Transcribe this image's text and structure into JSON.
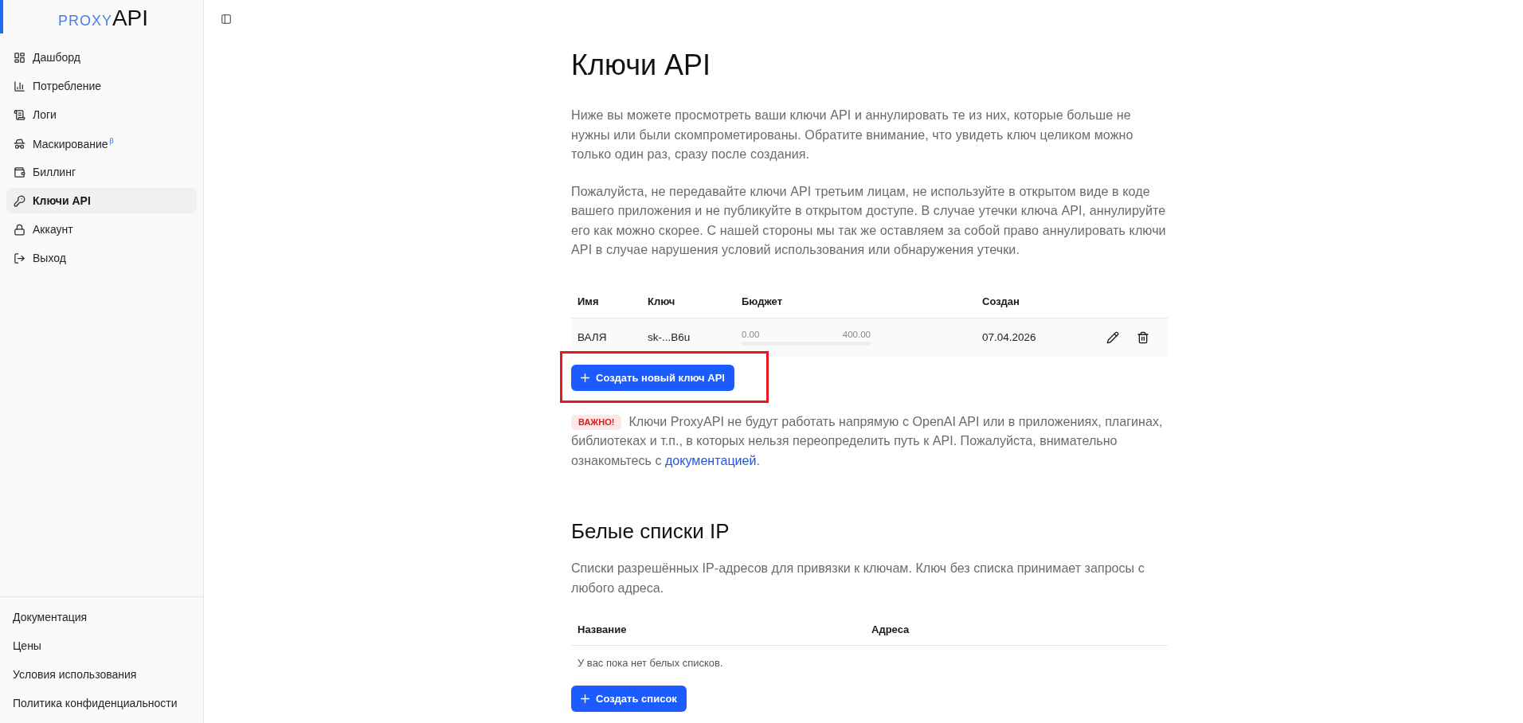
{
  "sidebar": {
    "logo": {
      "part_1": "PROXY",
      "part_2": "API"
    },
    "nav_items": [
      {
        "label": "Дашборд",
        "selected": false
      },
      {
        "label": "Потребление",
        "selected": false
      },
      {
        "label": "Логи",
        "selected": false
      },
      {
        "label": "Маскирование$^{β}$",
        "selected": false
      },
      {
        "label": "Биллинг",
        "selected": false
      },
      {
        "label": "Ключи API",
        "selected": true
      },
      {
        "label": "Аккаунт",
        "selected": false
      },
      {
        "label": "Выход",
        "selected": false
      }
    ],
    "footer_links": [
      "Документация",
      "Цены",
      "Условия использования",
      "Политика конфиденциальности"
    ]
  },
  "page": {
    "title": "Ключи API",
    "paragraphs": [
      "Ниже вы можете просмотреть ваши ключи API и аннулировать те из них, которые больше не нужны или были скомпрометированы. Обратите внимание, что увидеть ключ целиком можно только один раз, сразу после создания.",
      "Пожалуйста, не передавайте ключи API третьим лицам, не используйте в открытом виде в коде вашего приложения и не публикуйте в открытом доступе. В случае утечки ключа API, аннулируйте его как можно скорее. С нашей стороны мы так же оставляем за собой право аннулировать ключи API в случае нарушения условий использования или обнаружения утечки."
    ]
  },
  "keys_table": {
    "columns": [
      "Имя",
      "Ключ",
      "Бюджет",
      "Создан"
    ],
    "rows": [
      {
        "name": "ВАЛЯ",
        "key": "sk-...B6u",
        "budget_spent": "0.00",
        "budget_limit": "400.00",
        "created": "07.04.2026"
      }
    ]
  },
  "create_key_button": {
    "label": "Создать новый ключ API",
    "highlighted": true
  },
  "notice": {
    "badge": "ВАЖНО!",
    "text": "Ключи ProxyAPI не будут работать напрямую с OpenAI API или в приложениях, плагинах, библиотеках и т.п., в которых нельзя переопределить путь к API. Пожалуйста, внимательно ознакомьтесь с",
    "link": "документацией",
    "text_end": "."
  },
  "whitelists": {
    "title": "Белые списки IP",
    "description": "Списки разрешённых IP-адресов для привязки к ключам. Ключ без списка принимает запросы с любого адреса.",
    "columns": [
      "Название",
      "Адреса"
    ],
    "empty_message": "У вас пока нет белых списков.",
    "create_button": "Создать список"
  }
}
